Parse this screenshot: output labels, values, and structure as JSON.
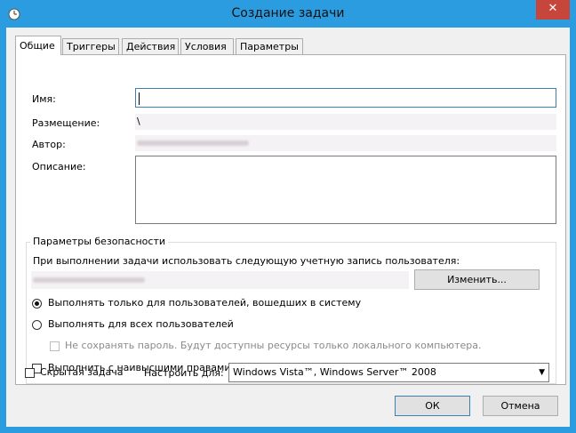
{
  "window": {
    "title": "Создание задачи",
    "close_glyph": "✕",
    "accent": "#2b9ce0"
  },
  "tabs": [
    {
      "label": "Общие",
      "active": true
    },
    {
      "label": "Триггеры"
    },
    {
      "label": "Действия"
    },
    {
      "label": "Условия"
    },
    {
      "label": "Параметры"
    }
  ],
  "general": {
    "name_label": "Имя:",
    "name_value": "",
    "location_label": "Размещение:",
    "location_value": "\\",
    "author_label": "Автор:",
    "description_label": "Описание:",
    "description_value": ""
  },
  "security": {
    "title": "Параметры безопасности",
    "account_prompt": "При выполнении задачи использовать следующую учетную запись пользователя:",
    "change_button": "Изменить...",
    "radio_logged_on": "Выполнять только для пользователей, вошедших в систему",
    "radio_all_users": "Выполнять для всех пользователей",
    "no_store_password": "Не сохранять пароль. Будут доступны ресурсы только локального компьютера.",
    "highest_privileges": "Выполнить с наивысшими правами"
  },
  "bottom": {
    "hidden_task": "Скрытая задача",
    "configure_for_label": "Настроить для:",
    "configure_for_value": "Windows Vista™, Windows Server™ 2008",
    "ok_button": "ОК",
    "cancel_button": "Отмена"
  }
}
